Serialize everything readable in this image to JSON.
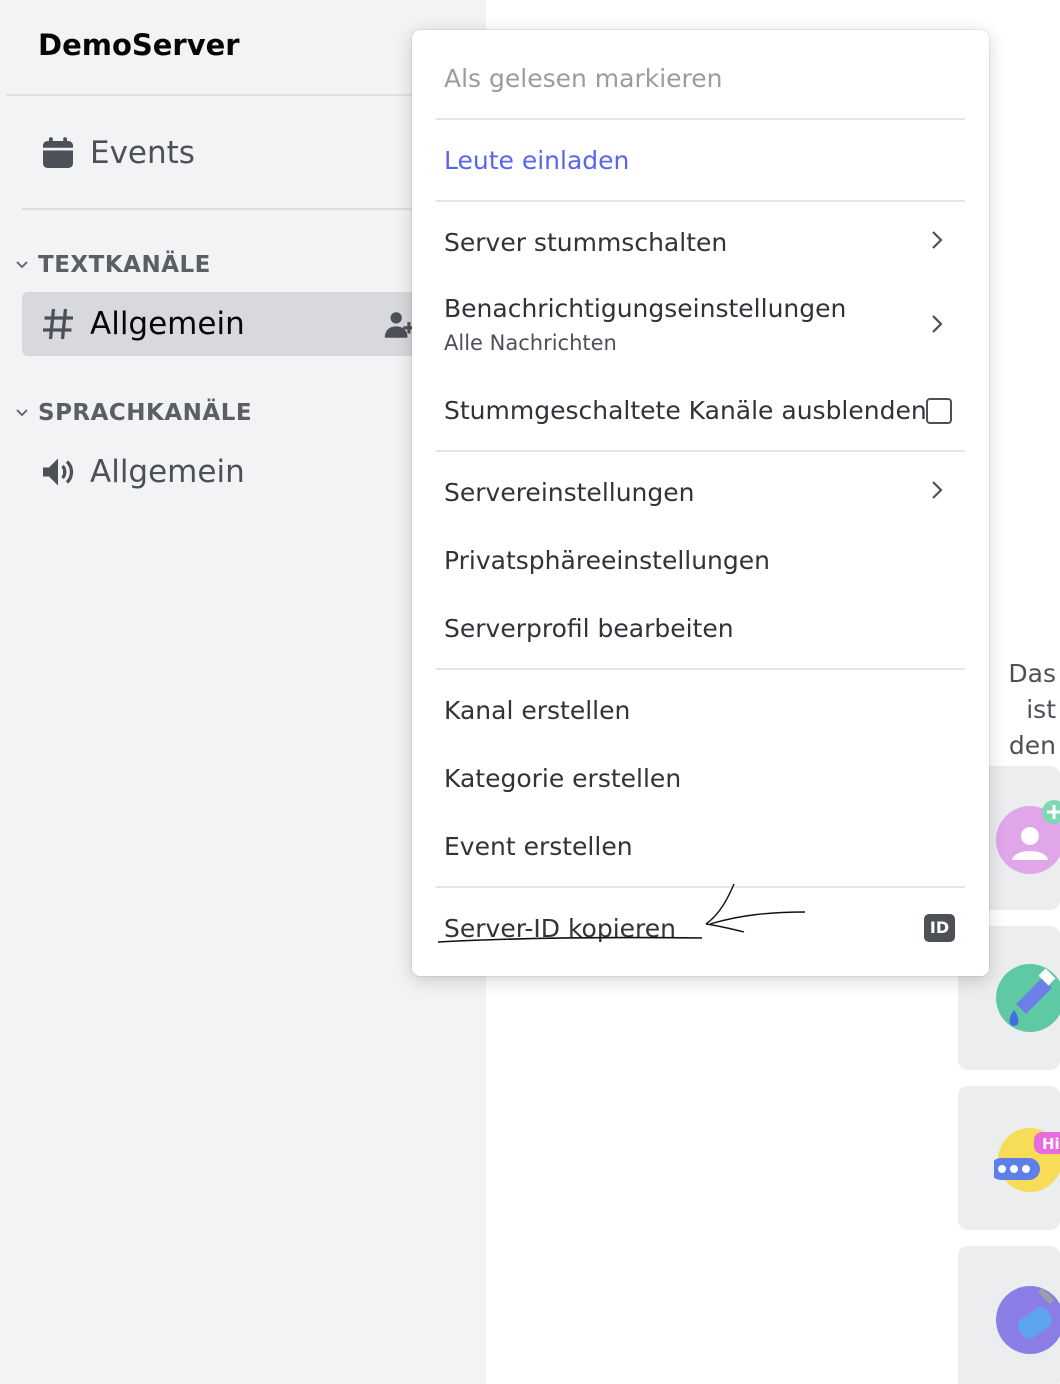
{
  "sidebar": {
    "server_name": "DemoServer",
    "events_label": "Events",
    "categories": [
      {
        "label": "TEXTKANÄLE",
        "channels": [
          {
            "label": "Allgemein",
            "type": "text",
            "active": true
          }
        ]
      },
      {
        "label": "SPRACHKANÄLE",
        "channels": [
          {
            "label": "Allgemein",
            "type": "voice",
            "active": false
          }
        ]
      }
    ]
  },
  "main": {
    "peek_line1": "Das ist",
    "peek_line2": "den"
  },
  "menu": {
    "mark_read": "Als gelesen markieren",
    "invite": "Leute einladen",
    "mute_server": "Server stummschalten",
    "notifications": "Benachrichtigungseinstellungen",
    "notifications_sub": "Alle Nachrichten",
    "hide_muted": "Stummgeschaltete Kanäle ausblenden",
    "server_settings": "Servereinstellungen",
    "privacy_settings": "Privatsphäreeinstellungen",
    "edit_profile": "Serverprofil bearbeiten",
    "create_channel": "Kanal erstellen",
    "create_category": "Kategorie erstellen",
    "create_event": "Event erstellen",
    "copy_id": "Server-ID kopieren",
    "id_badge": "ID"
  },
  "colors": {
    "brand": "#5865f2",
    "sidebar_bg": "#f2f3f5",
    "active_channel_bg": "#d7d9dc"
  },
  "icons": [
    "calendar-icon",
    "chevron-down-icon",
    "hash-icon",
    "add-member-icon",
    "speaker-icon",
    "chevron-right-icon",
    "id-icon"
  ]
}
